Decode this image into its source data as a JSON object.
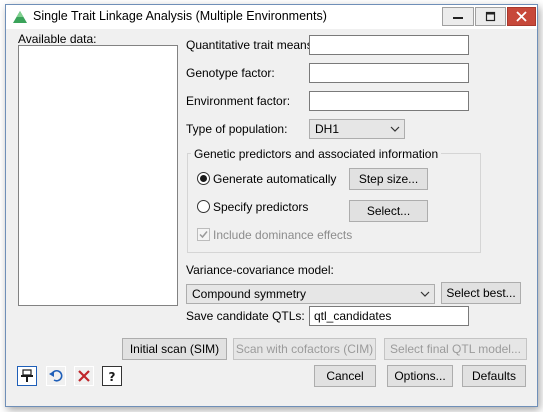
{
  "window": {
    "title": "Single Trait Linkage Analysis (Multiple Environments)"
  },
  "available_data": {
    "label": "Available data:"
  },
  "fields": {
    "trait_means": {
      "label": "Quantitative trait means:",
      "value": ""
    },
    "genotype_factor": {
      "label": "Genotype factor:",
      "value": ""
    },
    "environment_factor": {
      "label": "Environment factor:",
      "value": ""
    },
    "population_type": {
      "label": "Type of population:",
      "value": "DH1"
    }
  },
  "genetic_group": {
    "title": "Genetic predictors and associated information",
    "generate_auto_label": "Generate automatically",
    "generate_auto_selected": true,
    "specify_predictors_label": "Specify predictors",
    "specify_predictors_selected": false,
    "dominance_label": "Include dominance effects",
    "dominance_checked": true,
    "step_size_button": "Step size...",
    "select_button": "Select..."
  },
  "vcov": {
    "label": "Variance-covariance model:",
    "value": "Compound symmetry",
    "select_best_button": "Select best..."
  },
  "save_qtls": {
    "label": "Save candidate QTLs:",
    "value": "qtl_candidates"
  },
  "actions": {
    "initial_scan": "Initial scan (SIM)",
    "scan_cofactors": "Scan with cofactors (CIM)",
    "select_final": "Select final QTL model..."
  },
  "footer": {
    "cancel": "Cancel",
    "options": "Options...",
    "defaults": "Defaults"
  },
  "icons": {
    "app": "triangle-logo-icon",
    "pin": "pin-icon",
    "undo": "undo-icon",
    "clear": "clear-icon",
    "help": "help-icon"
  },
  "colors": {
    "close_button": "#c7483a",
    "icon_blue": "#1f5fb8",
    "icon_red": "#c0262b"
  }
}
